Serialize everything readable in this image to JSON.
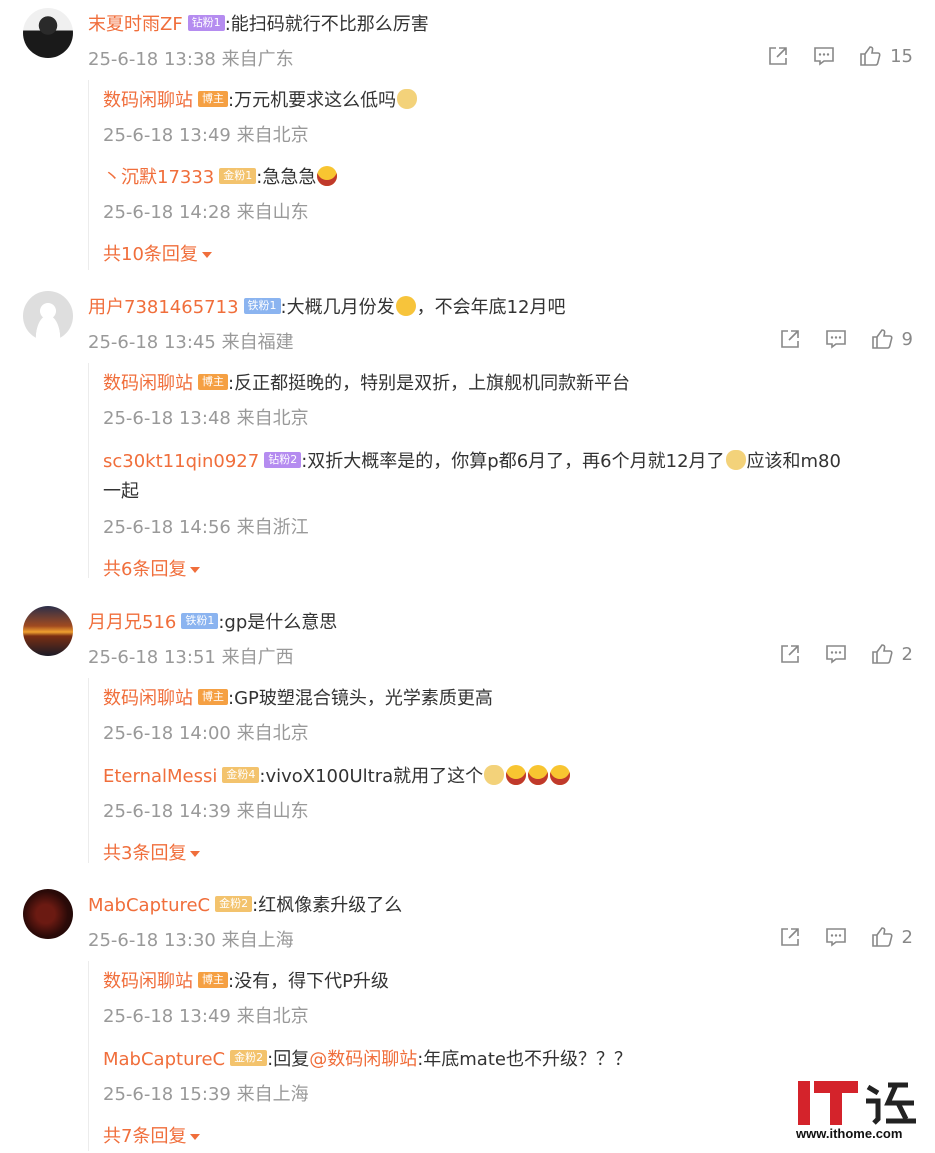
{
  "comments": [
    {
      "user": "末夏时雨ZF",
      "badge": "钻粉1",
      "text": ":能扫码就行不比那么厉害",
      "time": "25-6-18 13:38 来自广东",
      "likes": "15",
      "replies": [
        {
          "user": "数码闲聊站",
          "badge": "博主",
          "text": ":万元机要求这么低吗",
          "time": "25-6-18 13:49 来自北京"
        },
        {
          "user": "丶沉默17333",
          "badge": "金粉1",
          "text": ":急急急",
          "time": "25-6-18 14:28 来自山东"
        }
      ],
      "more": "共10条回复"
    },
    {
      "user": "用户7381465713",
      "badge": "铁粉1",
      "text": ":大概几月份发",
      "text2": "，不会年底12月吧",
      "time": "25-6-18 13:45 来自福建",
      "likes": "9",
      "replies": [
        {
          "user": "数码闲聊站",
          "badge": "博主",
          "text": ":反正都挺晚的，特别是双折，上旗舰机同款新平台",
          "time": "25-6-18 13:48 来自北京"
        },
        {
          "user": "sc30kt11qin0927",
          "badge": "钻粉2",
          "text": ":双折大概率是的，你算p都6月了，再6个月就12月了",
          "text2": "应该和m80",
          "text3": "一起",
          "time": "25-6-18 14:56 来自浙江"
        }
      ],
      "more": "共6条回复"
    },
    {
      "user": "月月兄516",
      "badge": "铁粉1",
      "text": ":gp是什么意思",
      "time": "25-6-18 13:51 来自广西",
      "likes": "2",
      "replies": [
        {
          "user": "数码闲聊站",
          "badge": "博主",
          "text": ":GP玻塑混合镜头，光学素质更高",
          "time": "25-6-18 14:00 来自北京"
        },
        {
          "user": "EternalMessi",
          "badge": "金粉4",
          "text": ":vivoX100Ultra就用了这个",
          "time": "25-6-18 14:39 来自山东"
        }
      ],
      "more": "共3条回复"
    },
    {
      "user": "MabCaptureC",
      "badge": "金粉2",
      "text": ":红枫像素升级了么",
      "time": "25-6-18 13:30 来自上海",
      "likes": "2",
      "replies": [
        {
          "user": "数码闲聊站",
          "badge": "博主",
          "text": ":没有，得下代P升级",
          "time": "25-6-18 13:49 来自北京"
        },
        {
          "user": "MabCaptureC",
          "badge": "金粉2",
          "text_prefix": ":回复",
          "mention": "@数码闲聊站",
          "text": ":年底mate也不升级？？？",
          "time": "25-6-18 15:39 来自上海"
        }
      ],
      "more": "共7条回复"
    }
  ],
  "watermark": {
    "logo": "IT之家",
    "url": "www.ithome.com"
  },
  "colors": {
    "username": "#f06e3b",
    "meta": "#999999",
    "text": "#333333"
  }
}
